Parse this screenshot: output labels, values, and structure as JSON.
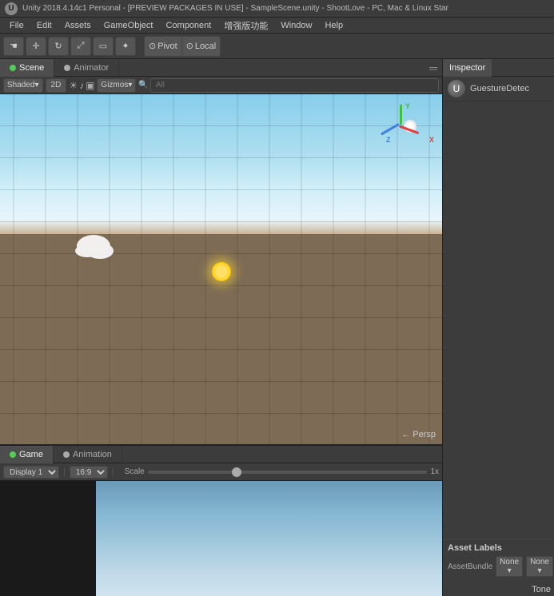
{
  "titleBar": {
    "text": "Unity 2018.4.14c1 Personal - [PREVIEW PACKAGES IN USE] - SampleScene.unity - ShootLove - PC, Mac & Linux Star"
  },
  "menuBar": {
    "items": [
      "File",
      "Edit",
      "Assets",
      "GameObject",
      "Component",
      "增强版功能",
      "Window",
      "Help"
    ]
  },
  "toolbar": {
    "pivot_label": "Pivot",
    "local_label": "Local",
    "tools": [
      "hand",
      "move",
      "rotate",
      "scale",
      "rect",
      "transform"
    ]
  },
  "sceneTabs": {
    "tabs": [
      {
        "label": "Scene",
        "icon": "⊙",
        "active": true
      },
      {
        "label": "Animator",
        "icon": "⊙",
        "active": false
      }
    ]
  },
  "sceneToolbar": {
    "shaded_label": "Shaded",
    "mode_2d": "2D",
    "gizmos_label": "Gizmos",
    "search_placeholder": "All",
    "collapse_icon": "═"
  },
  "sceneView": {
    "persp_label": "← Persp",
    "axes": {
      "x": "X",
      "y": "Y",
      "z": "Z"
    }
  },
  "inspector": {
    "tab_label": "Inspector",
    "object_name": "GuestureDetec",
    "unity_icon": "U",
    "asset_labels": {
      "title": "Asset Labels",
      "bundle_label": "AssetBundle",
      "bundle_value": "None",
      "none_label": "None"
    }
  },
  "bottomTabs": {
    "tabs": [
      {
        "label": "Game",
        "icon": "⊙",
        "active": true
      },
      {
        "label": "Animation",
        "icon": "⊙",
        "active": false
      }
    ]
  },
  "bottomToolbar": {
    "display_label": "Display 1",
    "ratio_label": "16:9",
    "scale_label": "Scale",
    "scale_value": "1x"
  },
  "toneLabel": "Tone"
}
